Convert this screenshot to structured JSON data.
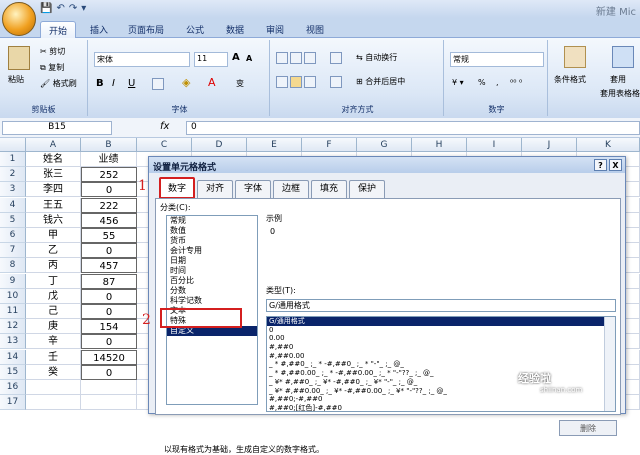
{
  "window": {
    "title": "新建 Mic"
  },
  "ribbon": {
    "tabs": [
      "开始",
      "插入",
      "页面布局",
      "公式",
      "数据",
      "审阅",
      "视图"
    ],
    "active_tab": "开始",
    "clipboard": {
      "paste": "粘贴",
      "cut": "剪切",
      "copy": "复制",
      "format_painter": "格式刷",
      "label": "剪贴板"
    },
    "font": {
      "name": "宋体",
      "size": "11",
      "grow": "A",
      "shrink": "A",
      "bold": "B",
      "italic": "I",
      "underline": "U",
      "wen": "变",
      "label": "字体"
    },
    "alignment": {
      "wrap": "自动换行",
      "merge": "合并后居中",
      "label": "对齐方式"
    },
    "number": {
      "format": "常规",
      "percent": "%",
      "comma": ",",
      "label": "数字"
    },
    "styles": {
      "conditional": "条件格式",
      "table": "套用表格格式",
      "table_short": "套用"
    }
  },
  "formula_bar": {
    "name_box": "B15",
    "fx": "fx",
    "value": "0"
  },
  "grid": {
    "columns": [
      "A",
      "B",
      "C",
      "D",
      "E",
      "F",
      "G",
      "H",
      "I",
      "J",
      "K"
    ],
    "rows": [
      "1",
      "2",
      "3",
      "4",
      "5",
      "6",
      "7",
      "8",
      "9",
      "10",
      "11",
      "12",
      "13",
      "14",
      "15",
      "16",
      "17"
    ],
    "col_a": [
      "姓名",
      "张三",
      "李四",
      "王五",
      "钱六",
      "甲",
      "乙",
      "丙",
      "丁",
      "戊",
      "己",
      "庚",
      "辛",
      "壬",
      "癸",
      "",
      ""
    ],
    "col_b": [
      "业绩",
      "252",
      "0",
      "222",
      "456",
      "55",
      "0",
      "457",
      "87",
      "0",
      "0",
      "154",
      "0",
      "14520",
      "0",
      "",
      ""
    ]
  },
  "dialog": {
    "title": "设置单元格格式",
    "help": "?",
    "close": "X",
    "tabs": [
      "数字",
      "对齐",
      "字体",
      "边框",
      "填充",
      "保护"
    ],
    "active_tab": "数字",
    "category_label": "分类(C):",
    "categories": [
      "常规",
      "数值",
      "货币",
      "会计专用",
      "日期",
      "时间",
      "百分比",
      "分数",
      "科学记数",
      "文本",
      "特殊",
      "自定义"
    ],
    "selected_category": "自定义",
    "sample_label": "示例",
    "sample_value": "0",
    "type_label": "类型(T):",
    "type_value": "G/通用格式",
    "formats": [
      "G/通用格式",
      "0",
      "0.00",
      "#,##0",
      "#,##0.00",
      "_ * #,##0_ ;_ * -#,##0_ ;_ * \"-\"_ ;_ @_",
      "_ * #,##0.00_ ;_ * -#,##0.00_ ;_ * \"-\"??_ ;_ @_",
      "_ ¥* #,##0_ ;_ ¥* -#,##0_ ;_ ¥* \"-\"_ ;_ @_",
      "_ ¥* #,##0.00_ ;_ ¥* -#,##0.00_ ;_ ¥* \"-\"??_ ;_ @_",
      "#,##0;-#,##0",
      "#,##0;[红色]-#,##0"
    ],
    "delete_button": "删除",
    "footer": "以现有格式为基础，生成自定义的数字格式。"
  },
  "annotations": {
    "marker1": "1",
    "marker2": "2"
  },
  "watermark": {
    "text": "经验啦",
    "sub": "shiinan.com"
  },
  "colors": {
    "accent": "#d41f1f",
    "selection": "#0a246a",
    "ribbon": "#dbe7f6"
  }
}
